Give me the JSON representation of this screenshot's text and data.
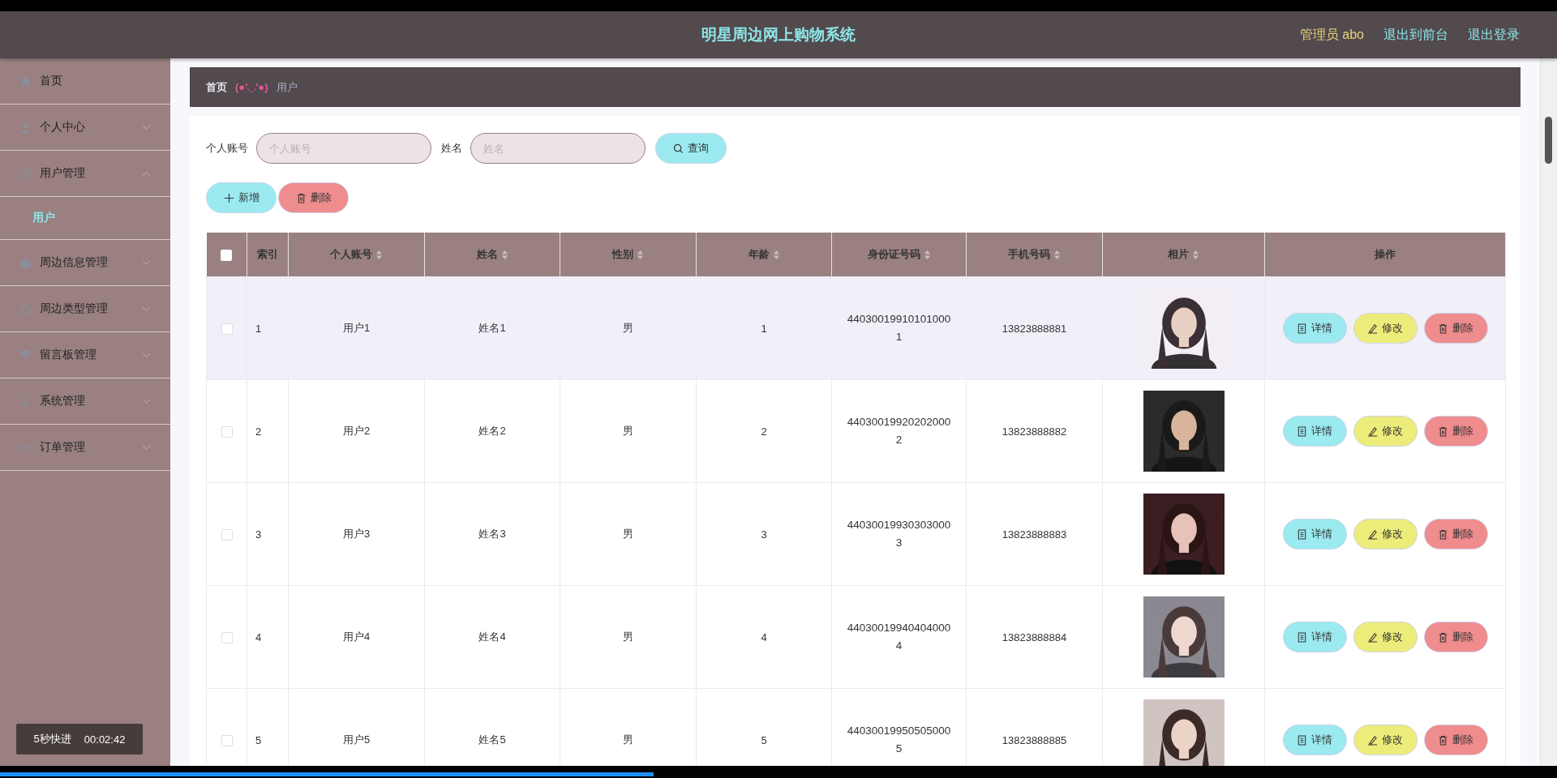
{
  "header": {
    "title": "明星周边网上购物系统",
    "user": "管理员 abo",
    "links": [
      "退出到前台",
      "退出登录"
    ]
  },
  "sidebar": {
    "items": [
      {
        "label": "首页",
        "has_children": false
      },
      {
        "label": "个人中心",
        "expanded": false,
        "has_children": true
      },
      {
        "label": "用户管理",
        "expanded": true,
        "has_children": true,
        "children": [
          {
            "label": "用户",
            "selected": true
          }
        ]
      },
      {
        "label": "周边信息管理",
        "expanded": false,
        "has_children": true
      },
      {
        "label": "周边类型管理",
        "expanded": false,
        "has_children": true
      },
      {
        "label": "留言板管理",
        "expanded": false,
        "has_children": true
      },
      {
        "label": "系统管理",
        "expanded": false,
        "has_children": true
      },
      {
        "label": "订单管理",
        "expanded": false,
        "has_children": true
      }
    ]
  },
  "breadcrumb": {
    "home": "首页",
    "separator": "(●'◡'●)",
    "current": "用户"
  },
  "search": {
    "fields": [
      {
        "label": "个人账号",
        "placeholder": "个人账号"
      },
      {
        "label": "姓名",
        "placeholder": "姓名"
      }
    ],
    "button": "查询"
  },
  "actions": [
    {
      "kind": "add",
      "label": "新增"
    },
    {
      "kind": "delete",
      "label": "删除"
    }
  ],
  "table": {
    "all_checked": false,
    "columns": [
      {
        "label": "索引",
        "sortable": false
      },
      {
        "label": "个人账号",
        "sortable": true
      },
      {
        "label": "姓名",
        "sortable": true
      },
      {
        "label": "性别",
        "sortable": true
      },
      {
        "label": "年龄",
        "sortable": true
      },
      {
        "label": "身份证号码",
        "sortable": true
      },
      {
        "label": "手机号码",
        "sortable": true
      },
      {
        "label": "相片",
        "sortable": true
      },
      {
        "label": "操作",
        "sortable": false
      }
    ],
    "rows": [
      {
        "index": "1",
        "account": "用户1",
        "name": "姓名1",
        "gender": "男",
        "age": "1",
        "id_number": "440300199101010001",
        "phone": "13823888881",
        "checked": false,
        "highlighted": true,
        "buttons": [
          {
            "kind": "detail",
            "label": "详情"
          },
          {
            "kind": "edit",
            "label": "修改"
          },
          {
            "kind": "delete",
            "label": "删除"
          }
        ]
      },
      {
        "index": "2",
        "account": "用户2",
        "name": "姓名2",
        "gender": "男",
        "age": "2",
        "id_number": "440300199202020002",
        "phone": "13823888882",
        "checked": false,
        "highlighted": false,
        "buttons": [
          {
            "kind": "detail",
            "label": "详情"
          },
          {
            "kind": "edit",
            "label": "修改"
          },
          {
            "kind": "delete",
            "label": "删除"
          }
        ]
      },
      {
        "index": "3",
        "account": "用户3",
        "name": "姓名3",
        "gender": "男",
        "age": "3",
        "id_number": "440300199303030003",
        "phone": "13823888883",
        "checked": false,
        "highlighted": false,
        "buttons": [
          {
            "kind": "detail",
            "label": "详情"
          },
          {
            "kind": "edit",
            "label": "修改"
          },
          {
            "kind": "delete",
            "label": "删除"
          }
        ]
      },
      {
        "index": "4",
        "account": "用户4",
        "name": "姓名4",
        "gender": "男",
        "age": "4",
        "id_number": "440300199404040004",
        "phone": "13823888884",
        "checked": false,
        "highlighted": false,
        "buttons": [
          {
            "kind": "detail",
            "label": "详情"
          },
          {
            "kind": "edit",
            "label": "修改"
          },
          {
            "kind": "delete",
            "label": "删除"
          }
        ]
      },
      {
        "index": "5",
        "account": "用户5",
        "name": "姓名5",
        "gender": "男",
        "age": "5",
        "id_number": "440300199505050005",
        "phone": "13823888885",
        "checked": false,
        "highlighted": false,
        "buttons": [
          {
            "kind": "detail",
            "label": "详情"
          },
          {
            "kind": "edit",
            "label": "修改"
          },
          {
            "kind": "delete",
            "label": "删除"
          }
        ]
      }
    ]
  },
  "player": {
    "skip_label": "5秒快进",
    "time": "00:02:42",
    "level": 0.42
  }
}
